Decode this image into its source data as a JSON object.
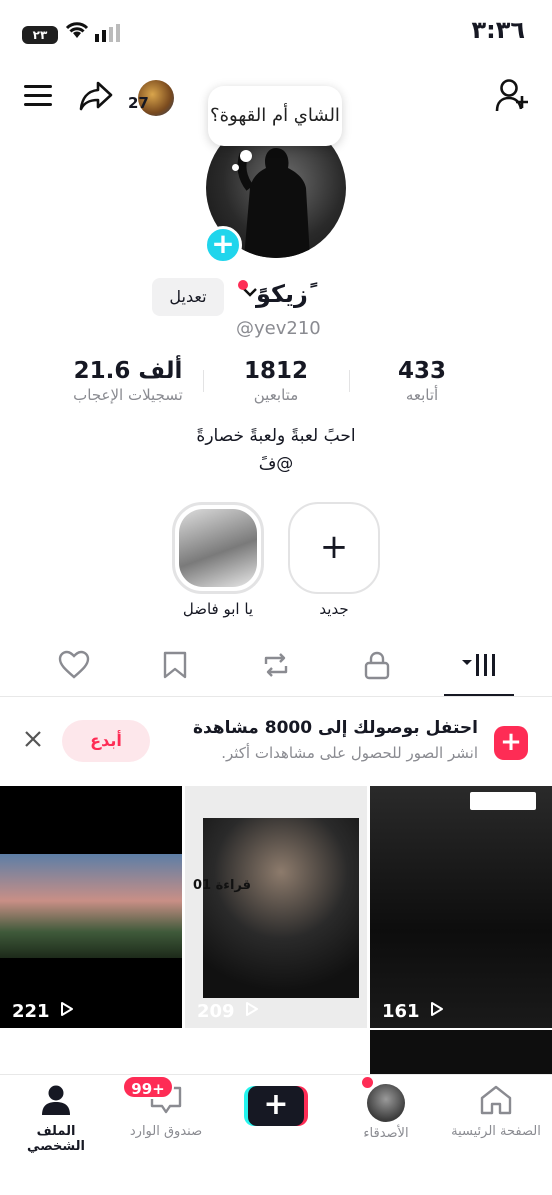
{
  "status_bar": {
    "time": "٣:٣٦",
    "battery": "٢٣"
  },
  "header": {
    "followers_preview_count": "27",
    "note_bubble": "الشاي أم القهوة؟"
  },
  "profile": {
    "name": "ًزيكوً",
    "edit_label": "تعديل",
    "username": "@yev210"
  },
  "stats": [
    {
      "value": "433",
      "label": "أتابعه"
    },
    {
      "value": "1812",
      "label": "متابعين"
    },
    {
      "value": "21.6 ألف",
      "label": "تسجيلات الإعجاب"
    }
  ],
  "bio": {
    "line1": "احبً لعبةً ولعبةً خصارةً",
    "line2": "@فً"
  },
  "highlights": {
    "new_label": "جديد",
    "story_label": "يا ابو فاضل"
  },
  "banner": {
    "title": "احتفل بوصولك إلى 8000 مشاهدة",
    "subtitle": "انشر الصور للحصول على مشاهدات أكثر.",
    "button": "أبدع"
  },
  "videos": [
    {
      "views": "221"
    },
    {
      "views": "209",
      "overlay_text": "قراءة 01"
    },
    {
      "views": "161"
    }
  ],
  "nav": {
    "home": "الصفحة الرئيسية",
    "friends": "الأصدقاء",
    "inbox": "صندوق الوارد",
    "inbox_badge": "99+",
    "profile": "الملف الشخصي"
  }
}
